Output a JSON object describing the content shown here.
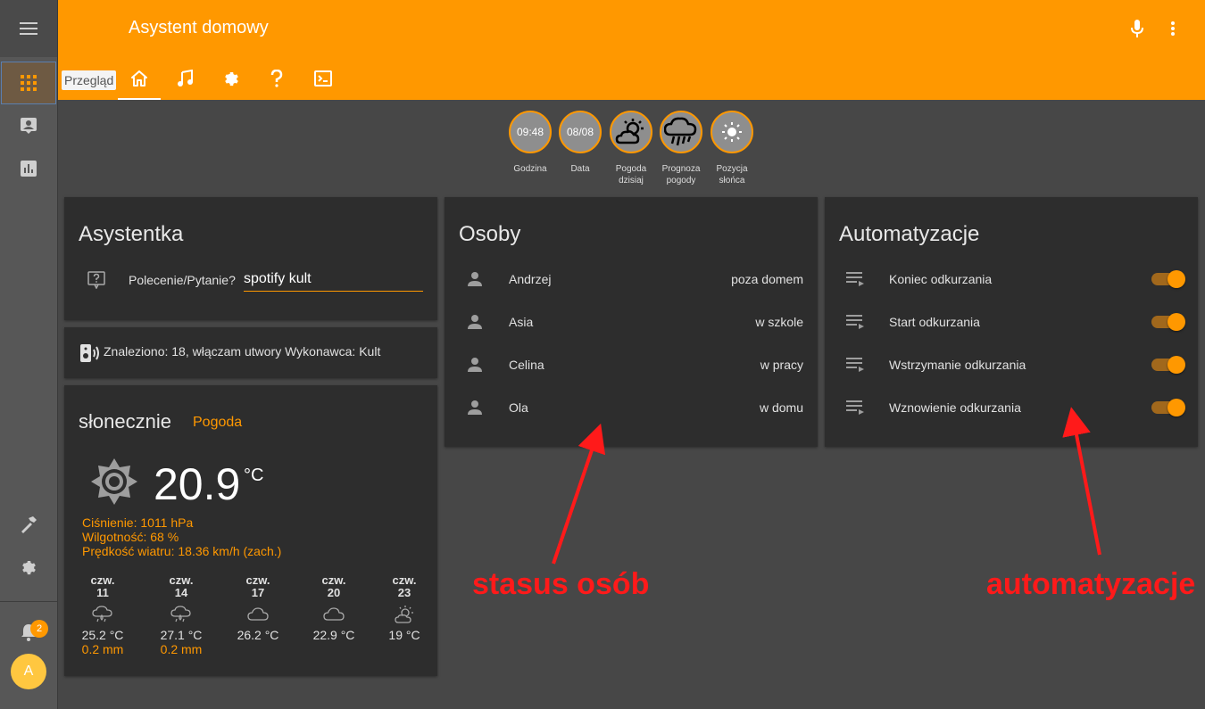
{
  "header": {
    "title": "Asystent domowy"
  },
  "tabs": {
    "tooltip": "Przegląd"
  },
  "sidebar": {
    "notification_count": "2",
    "avatar_letter": "A"
  },
  "badges": [
    {
      "value": "09:48",
      "label": "Godzina"
    },
    {
      "value": "08/08",
      "label": "Data"
    },
    {
      "value": "",
      "label": "Pogoda dzisiaj"
    },
    {
      "value": "",
      "label": "Prognoza pogody"
    },
    {
      "value": "",
      "label": "Pozycja słońca"
    }
  ],
  "assistant": {
    "title": "Asystentka",
    "command_label": "Polecenie/Pytanie?",
    "command_value": "spotify kult",
    "response": "Znaleziono: 18, włączam utwory Wykonawca: Kult"
  },
  "weather": {
    "condition": "słonecznie",
    "link": "Pogoda",
    "temperature": "20.9",
    "unit": "°C",
    "pressure": "Ciśnienie: 1011 hPa",
    "humidity": "Wilgotność: 68 %",
    "wind": "Prędkość wiatru: 18.36 km/h (zach.)",
    "forecast": [
      {
        "day": "czw.",
        "date": "11",
        "temp": "25.2 °C",
        "precip": "0.2 mm",
        "icon": "rain-cloud-icon"
      },
      {
        "day": "czw.",
        "date": "14",
        "temp": "27.1 °C",
        "precip": "0.2 mm",
        "icon": "rain-cloud-icon"
      },
      {
        "day": "czw.",
        "date": "17",
        "temp": "26.2 °C",
        "precip": "",
        "icon": "cloud-icon"
      },
      {
        "day": "czw.",
        "date": "20",
        "temp": "22.9 °C",
        "precip": "",
        "icon": "cloud-icon"
      },
      {
        "day": "czw.",
        "date": "23",
        "temp": "19 °C",
        "precip": "",
        "icon": "partly-cloudy-icon"
      }
    ]
  },
  "persons": {
    "title": "Osoby",
    "items": [
      {
        "name": "Andrzej",
        "state": "poza domem"
      },
      {
        "name": "Asia",
        "state": "w szkole"
      },
      {
        "name": "Celina",
        "state": "w pracy"
      },
      {
        "name": "Ola",
        "state": "w domu"
      }
    ]
  },
  "automations": {
    "title": "Automatyzacje",
    "items": [
      {
        "name": "Koniec odkurzania",
        "on": true
      },
      {
        "name": "Start odkurzania",
        "on": true
      },
      {
        "name": "Wstrzymanie odkurzania",
        "on": true
      },
      {
        "name": "Wznowienie odkurzania",
        "on": true
      }
    ]
  },
  "annotations": {
    "persons_label": "stasus osób",
    "automations_label": "automatyzacje",
    "color": "#ff1a1a"
  },
  "colors": {
    "accent": "#ff9800",
    "card": "#2d2d2d",
    "background": "#474747"
  }
}
